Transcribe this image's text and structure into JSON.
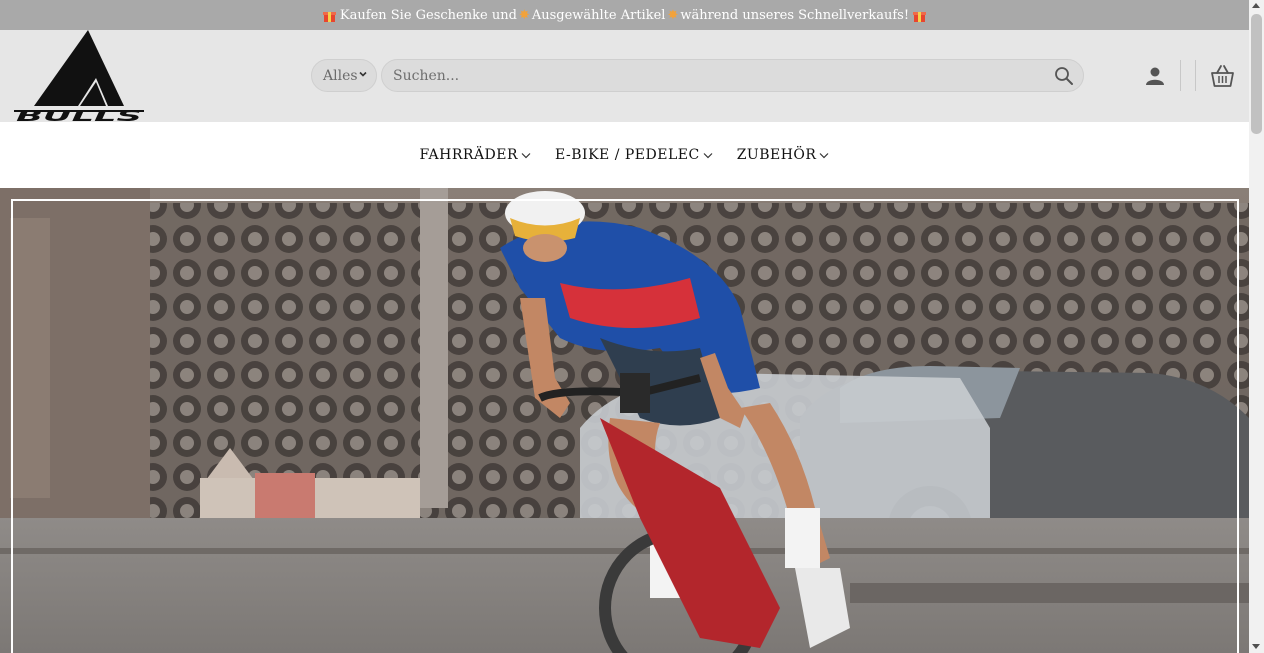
{
  "announcement": {
    "part1": "Kaufen Sie Geschenke und",
    "highlight": "Ausgewählte Artikel",
    "part2": "während unseres Schnellverkaufs!",
    "gift_icon": "gift-icon",
    "star_icon": "sparkle-icon"
  },
  "header": {
    "logo_text": "BULLS",
    "category_select": {
      "value": "Alles"
    },
    "search": {
      "placeholder": "Suchen..."
    },
    "icons": [
      "user-icon",
      "cart-icon",
      "search-icon"
    ]
  },
  "nav": {
    "items": [
      {
        "label": "FAHRRÄDER"
      },
      {
        "label": "E-BIKE / PEDELEC"
      },
      {
        "label": "ZUBEHÖR"
      }
    ]
  },
  "hero": {
    "image": "cyclist-road-bike-photo"
  },
  "colors": {
    "topbar_bg": "#a9a9a9",
    "header_bg": "#e6e6e6",
    "accent_star": "#f2a23a"
  }
}
